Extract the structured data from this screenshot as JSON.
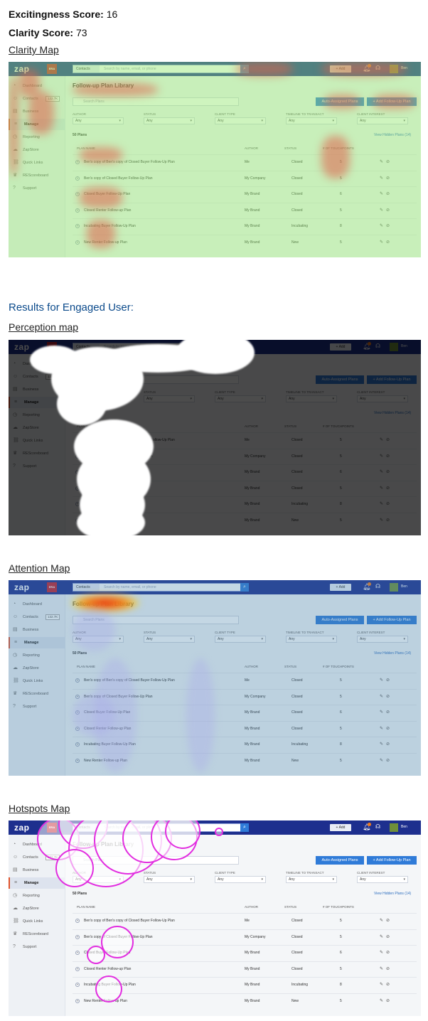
{
  "scores": {
    "excitingness_label": "Excitingness Score:",
    "excitingness_value": "16",
    "clarity_label": "Clarity Score:",
    "clarity_value": "73"
  },
  "sections": {
    "clarity_map": "Clarity Map",
    "results_heading": "Results for Engaged User:",
    "perception_map": "Perception map",
    "attention_map": "Attention Map",
    "hotspots_map": "Hotspots Map"
  },
  "app": {
    "logo": "zap",
    "brand": "ERA",
    "search_select": "Contacts",
    "search_placeholder": "Search by name, email, or phone",
    "add_button": "+ Add",
    "user_name": "Ben",
    "sidebar": [
      {
        "label": "Dashboard",
        "icon": "dashboard-icon",
        "glyph": "◔"
      },
      {
        "label": "Contacts",
        "icon": "contacts-icon",
        "glyph": "☺",
        "badge": "132.7K"
      },
      {
        "label": "Business",
        "icon": "business-icon",
        "glyph": "▤"
      },
      {
        "label": "Manage",
        "icon": "manage-icon",
        "glyph": "≡",
        "active": true
      },
      {
        "label": "Reporting",
        "icon": "reporting-icon",
        "glyph": "◷"
      },
      {
        "label": "ZapStore",
        "icon": "zapstore-icon",
        "glyph": "☁"
      },
      {
        "label": "Quick Links",
        "icon": "quick-links-icon",
        "glyph": "⛓"
      },
      {
        "label": "REScoreboard",
        "icon": "scoreboard-icon",
        "glyph": "♛"
      },
      {
        "label": "Support",
        "icon": "support-icon",
        "glyph": "?"
      }
    ],
    "page_title": "Follow-up Plan Library",
    "search_plans_placeholder": "Search Plans",
    "auto_assigned_button": "Auto-Assigned Plans",
    "add_plan_button": "+ Add Follow-Up Plan",
    "filters": [
      {
        "label": "AUTHOR",
        "value": "Any"
      },
      {
        "label": "STATUS",
        "value": "Any"
      },
      {
        "label": "CLIENT TYPE",
        "value": "Any"
      },
      {
        "label": "TIMELINE TO TRANSACT",
        "value": "Any"
      },
      {
        "label": "CLIENT INTEREST",
        "value": "Any"
      }
    ],
    "plan_count": "50 Plans",
    "view_hidden": "View Hidden Plans (14)",
    "columns": [
      "PLAN NAME",
      "AUTHOR",
      "STATUS",
      "# OF TOUCHPOINTS"
    ],
    "rows": [
      {
        "name": "Ben's copy of Ben's copy of Closed Buyer Follow-Up Plan",
        "author": "Me",
        "status": "Closed",
        "touchpoints": "5"
      },
      {
        "name": "Ben's copy of Closed Buyer Follow-Up Plan",
        "author": "My Company",
        "status": "Closed",
        "touchpoints": "5"
      },
      {
        "name": "Closed Buyer Follow-Up Plan",
        "author": "My Brand",
        "status": "Closed",
        "touchpoints": "6"
      },
      {
        "name": "Closed Renter Follow-up Plan",
        "author": "My Brand",
        "status": "Closed",
        "touchpoints": "5"
      },
      {
        "name": "Incubating Buyer Follow-Up Plan",
        "author": "My Brand",
        "status": "Incubating",
        "touchpoints": "8"
      },
      {
        "name": "New Renter Follow-up Plan",
        "author": "My Brand",
        "status": "New",
        "touchpoints": "5"
      }
    ]
  },
  "colors": {
    "accent_blue": "#2f7bd8",
    "nav_bar": "#1d2f8e",
    "clarity_red": "#e0604a",
    "clarity_green": "#92e66e",
    "heat_red": "#e8261a",
    "hotspot_ring": "#e22ee0",
    "section_title": "#0b4a8b"
  }
}
